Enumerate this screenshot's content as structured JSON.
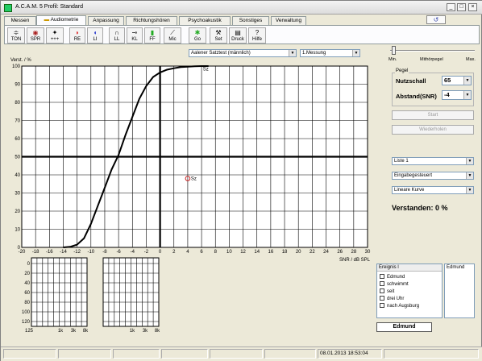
{
  "window": {
    "title": "A.C.A.M. 5  Profil: Standard",
    "min": "_",
    "max": "□",
    "close": "×"
  },
  "tabs": [
    {
      "label": "Messen"
    },
    {
      "label": "Audiometrie"
    },
    {
      "label": "Anpassung"
    },
    {
      "label": "Richtungshören"
    },
    {
      "label": "Psychoakustik"
    },
    {
      "label": "Sonstiges"
    },
    {
      "label": "Verwaltung"
    }
  ],
  "toolbar": [
    {
      "label": "TON",
      "icon": "≑"
    },
    {
      "label": "SPR",
      "icon": "◉"
    },
    {
      "label": "+++",
      "icon": "✦"
    },
    {
      "label": "RE",
      "icon": "◗"
    },
    {
      "label": "LI",
      "icon": "◖"
    },
    {
      "label": "LL",
      "icon": "∩"
    },
    {
      "label": "KL",
      "icon": "⊸"
    },
    {
      "label": "FF",
      "icon": "▮"
    },
    {
      "label": "Mic",
      "icon": "⟋"
    },
    {
      "label": "Go",
      "icon": "✱"
    },
    {
      "label": "Set",
      "icon": "⚒"
    },
    {
      "label": "Druck",
      "icon": "▤"
    },
    {
      "label": "Hilfe",
      "icon": "?"
    }
  ],
  "selects": {
    "test": "Aalener Satztest (männlich)",
    "messung": "1.Messung",
    "liste": "Liste 1",
    "steuerung": "Eingabegesteuert",
    "kurve": "Lineare Kurve"
  },
  "slider": {
    "min_label": "Min.",
    "mid_label": "Mithörpegel",
    "max_label": "Max."
  },
  "pegel": {
    "group_title": "Pegel",
    "nutzschall_label": "Nutzschall",
    "nutzschall_value": "65",
    "abstand_label": "Abstand(SNR)",
    "abstand_value": "-4"
  },
  "buttons": {
    "start": "Start",
    "wiederholen": "Wiederholen"
  },
  "result": {
    "verstanden": "Verstanden: 0 %"
  },
  "chart_data": {
    "type": "line",
    "ylabel": "Verst. / %",
    "xlabel": "SNR / dB SPL",
    "xlim": [
      -20,
      30
    ],
    "ylim": [
      0,
      100
    ],
    "x_ticks": [
      -20,
      -18,
      -16,
      -14,
      -12,
      -10,
      -8,
      -6,
      -4,
      -2,
      0,
      2,
      4,
      6,
      8,
      10,
      12,
      14,
      16,
      18,
      20,
      22,
      24,
      26,
      28,
      30
    ],
    "y_ticks": [
      0,
      10,
      20,
      30,
      40,
      50,
      60,
      70,
      80,
      90,
      100
    ],
    "series": [
      {
        "name": "Sz",
        "x": [
          -14,
          -13,
          -12,
          -11,
          -10,
          -9,
          -8,
          -7,
          -6,
          -5,
          -4,
          -3,
          -2,
          -1,
          0,
          1,
          2,
          3,
          4,
          5,
          6,
          7
        ],
        "y": [
          0,
          0.3,
          1.5,
          5,
          13,
          23,
          33,
          43,
          51,
          62,
          72,
          82,
          89,
          94,
          96.5,
          98,
          98.8,
          99.4,
          99.7,
          99.9,
          100,
          100
        ]
      }
    ],
    "markers": [
      {
        "label": "Sz",
        "x": 4,
        "y": 38
      }
    ],
    "curve_label": {
      "label": "Sz",
      "x": 6.2,
      "y": 97.5
    }
  },
  "mini_audiogram": {
    "y_labels": [
      "0",
      "20",
      "40",
      "60",
      "80",
      "100",
      "120"
    ],
    "x_labels": [
      "125",
      "1k",
      "3k",
      "8k"
    ]
  },
  "ereignis": {
    "header": "Ereignis l",
    "items": [
      "Edmund",
      "schwimmt",
      "seit",
      "drei Uhr",
      "nach Augsburg"
    ],
    "side_text": "Edmund",
    "current": "Edmund"
  },
  "status": {
    "datetime": "08.01.2013 18:53:04"
  }
}
